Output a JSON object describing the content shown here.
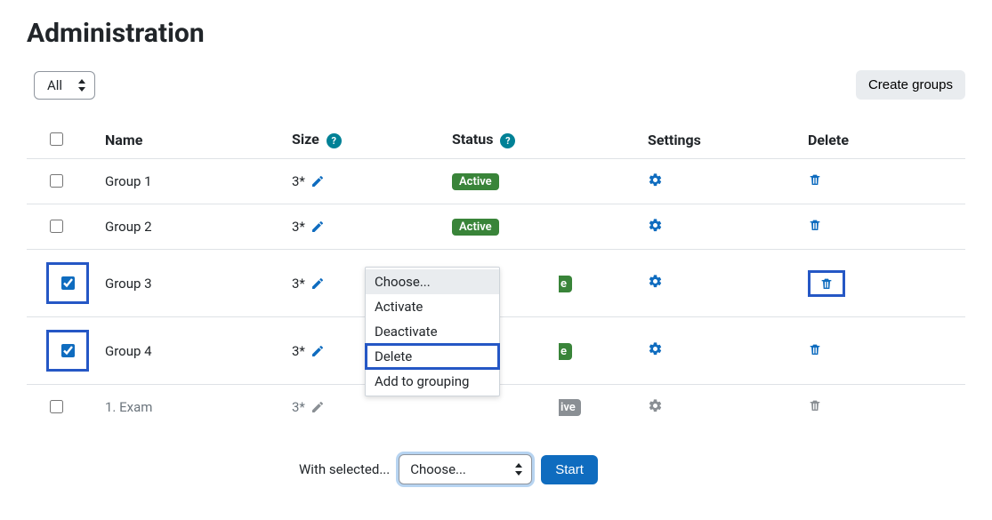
{
  "title": "Administration",
  "filter": {
    "selected": "All"
  },
  "buttons": {
    "create_groups": "Create groups",
    "start": "Start"
  },
  "columns": {
    "name": "Name",
    "size": "Size",
    "status": "Status",
    "settings": "Settings",
    "delete": "Delete"
  },
  "rows": [
    {
      "name": "Group 1",
      "size": "3*",
      "status": "Active",
      "status_kind": "green",
      "checked": false,
      "muted": false,
      "hl_check": false,
      "hl_delete": false,
      "partial_status_fragment": null
    },
    {
      "name": "Group 2",
      "size": "3*",
      "status": "Active",
      "status_kind": "green",
      "checked": false,
      "muted": false,
      "hl_check": false,
      "hl_delete": false,
      "partial_status_fragment": null
    },
    {
      "name": "Group 3",
      "size": "3*",
      "status": "Active",
      "status_kind": "green",
      "checked": true,
      "muted": false,
      "hl_check": true,
      "hl_delete": true,
      "partial_status_fragment": "e"
    },
    {
      "name": "Group 4",
      "size": "3*",
      "status": "Active",
      "status_kind": "green",
      "checked": true,
      "muted": false,
      "hl_check": true,
      "hl_delete": false,
      "partial_status_fragment": "e"
    },
    {
      "name": "1. Exam",
      "size": "3*",
      "status": "Active",
      "status_kind": "grey",
      "checked": false,
      "muted": true,
      "hl_check": false,
      "hl_delete": false,
      "partial_status_fragment": "ive"
    }
  ],
  "with_selected": {
    "label": "With selected...",
    "current": "Choose...",
    "options": [
      "Choose...",
      "Activate",
      "Deactivate",
      "Delete",
      "Add to grouping"
    ],
    "highlighted_option": "Delete"
  }
}
